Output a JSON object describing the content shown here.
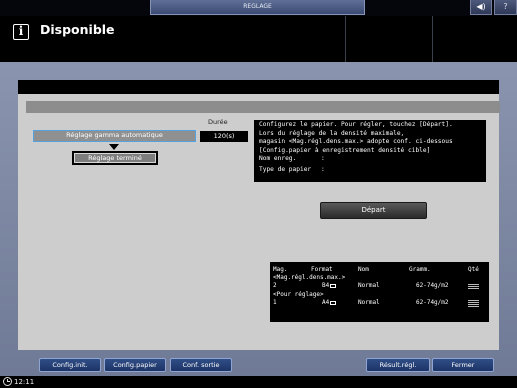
{
  "topbar": {
    "tab_label": "REGLAGE",
    "sound_icon": "speaker-icon",
    "help_label": "?"
  },
  "header": {
    "icon": "info-icon",
    "icon_glyph": "i",
    "status": "Disponible"
  },
  "gamma": {
    "duree_label": "Durée",
    "button_label": "Réglage gamma automatique",
    "duree_value": "120(s)",
    "termine_label": "Réglage terminé"
  },
  "message": {
    "lines": [
      "Configurez le papier. Pour régler, touchez [Départ].",
      "Lors du réglage de la densité maximale,",
      "magasin <Mag.régl.dens.max.> adopte conf. ci-dessous",
      "[Config.papier à enregistrement densité cible]"
    ],
    "nom_label": "Nom enreg.",
    "nom_value": ":",
    "type_label": "Type de papier",
    "type_value": ":"
  },
  "depart_label": "Départ",
  "tray": {
    "headers": [
      "Mag.",
      "Format",
      "Nom",
      "Gramm.",
      "Qté"
    ],
    "section1": "<Mag.régl.dens.max.>",
    "row1": {
      "mag": "2",
      "format": "B4",
      "nom": "Normal",
      "gramm": "62-74g/m2",
      "qty_icon": "paper-stack-icon"
    },
    "section2": "<Pour réglage>",
    "row2": {
      "mag": "1",
      "format": "A4",
      "nom": "Normal",
      "gramm": "62-74g/m2",
      "qty_icon": "paper-stack-icon"
    }
  },
  "buttons": {
    "config_init": "Config.init.",
    "config_papier": "Config.papier",
    "conf_sortie": "Conf. sortie",
    "result_regl": "Résult.régl.",
    "fermer": "Fermer"
  },
  "footer": {
    "time": "12:11",
    "clock_icon": "clock-icon"
  }
}
